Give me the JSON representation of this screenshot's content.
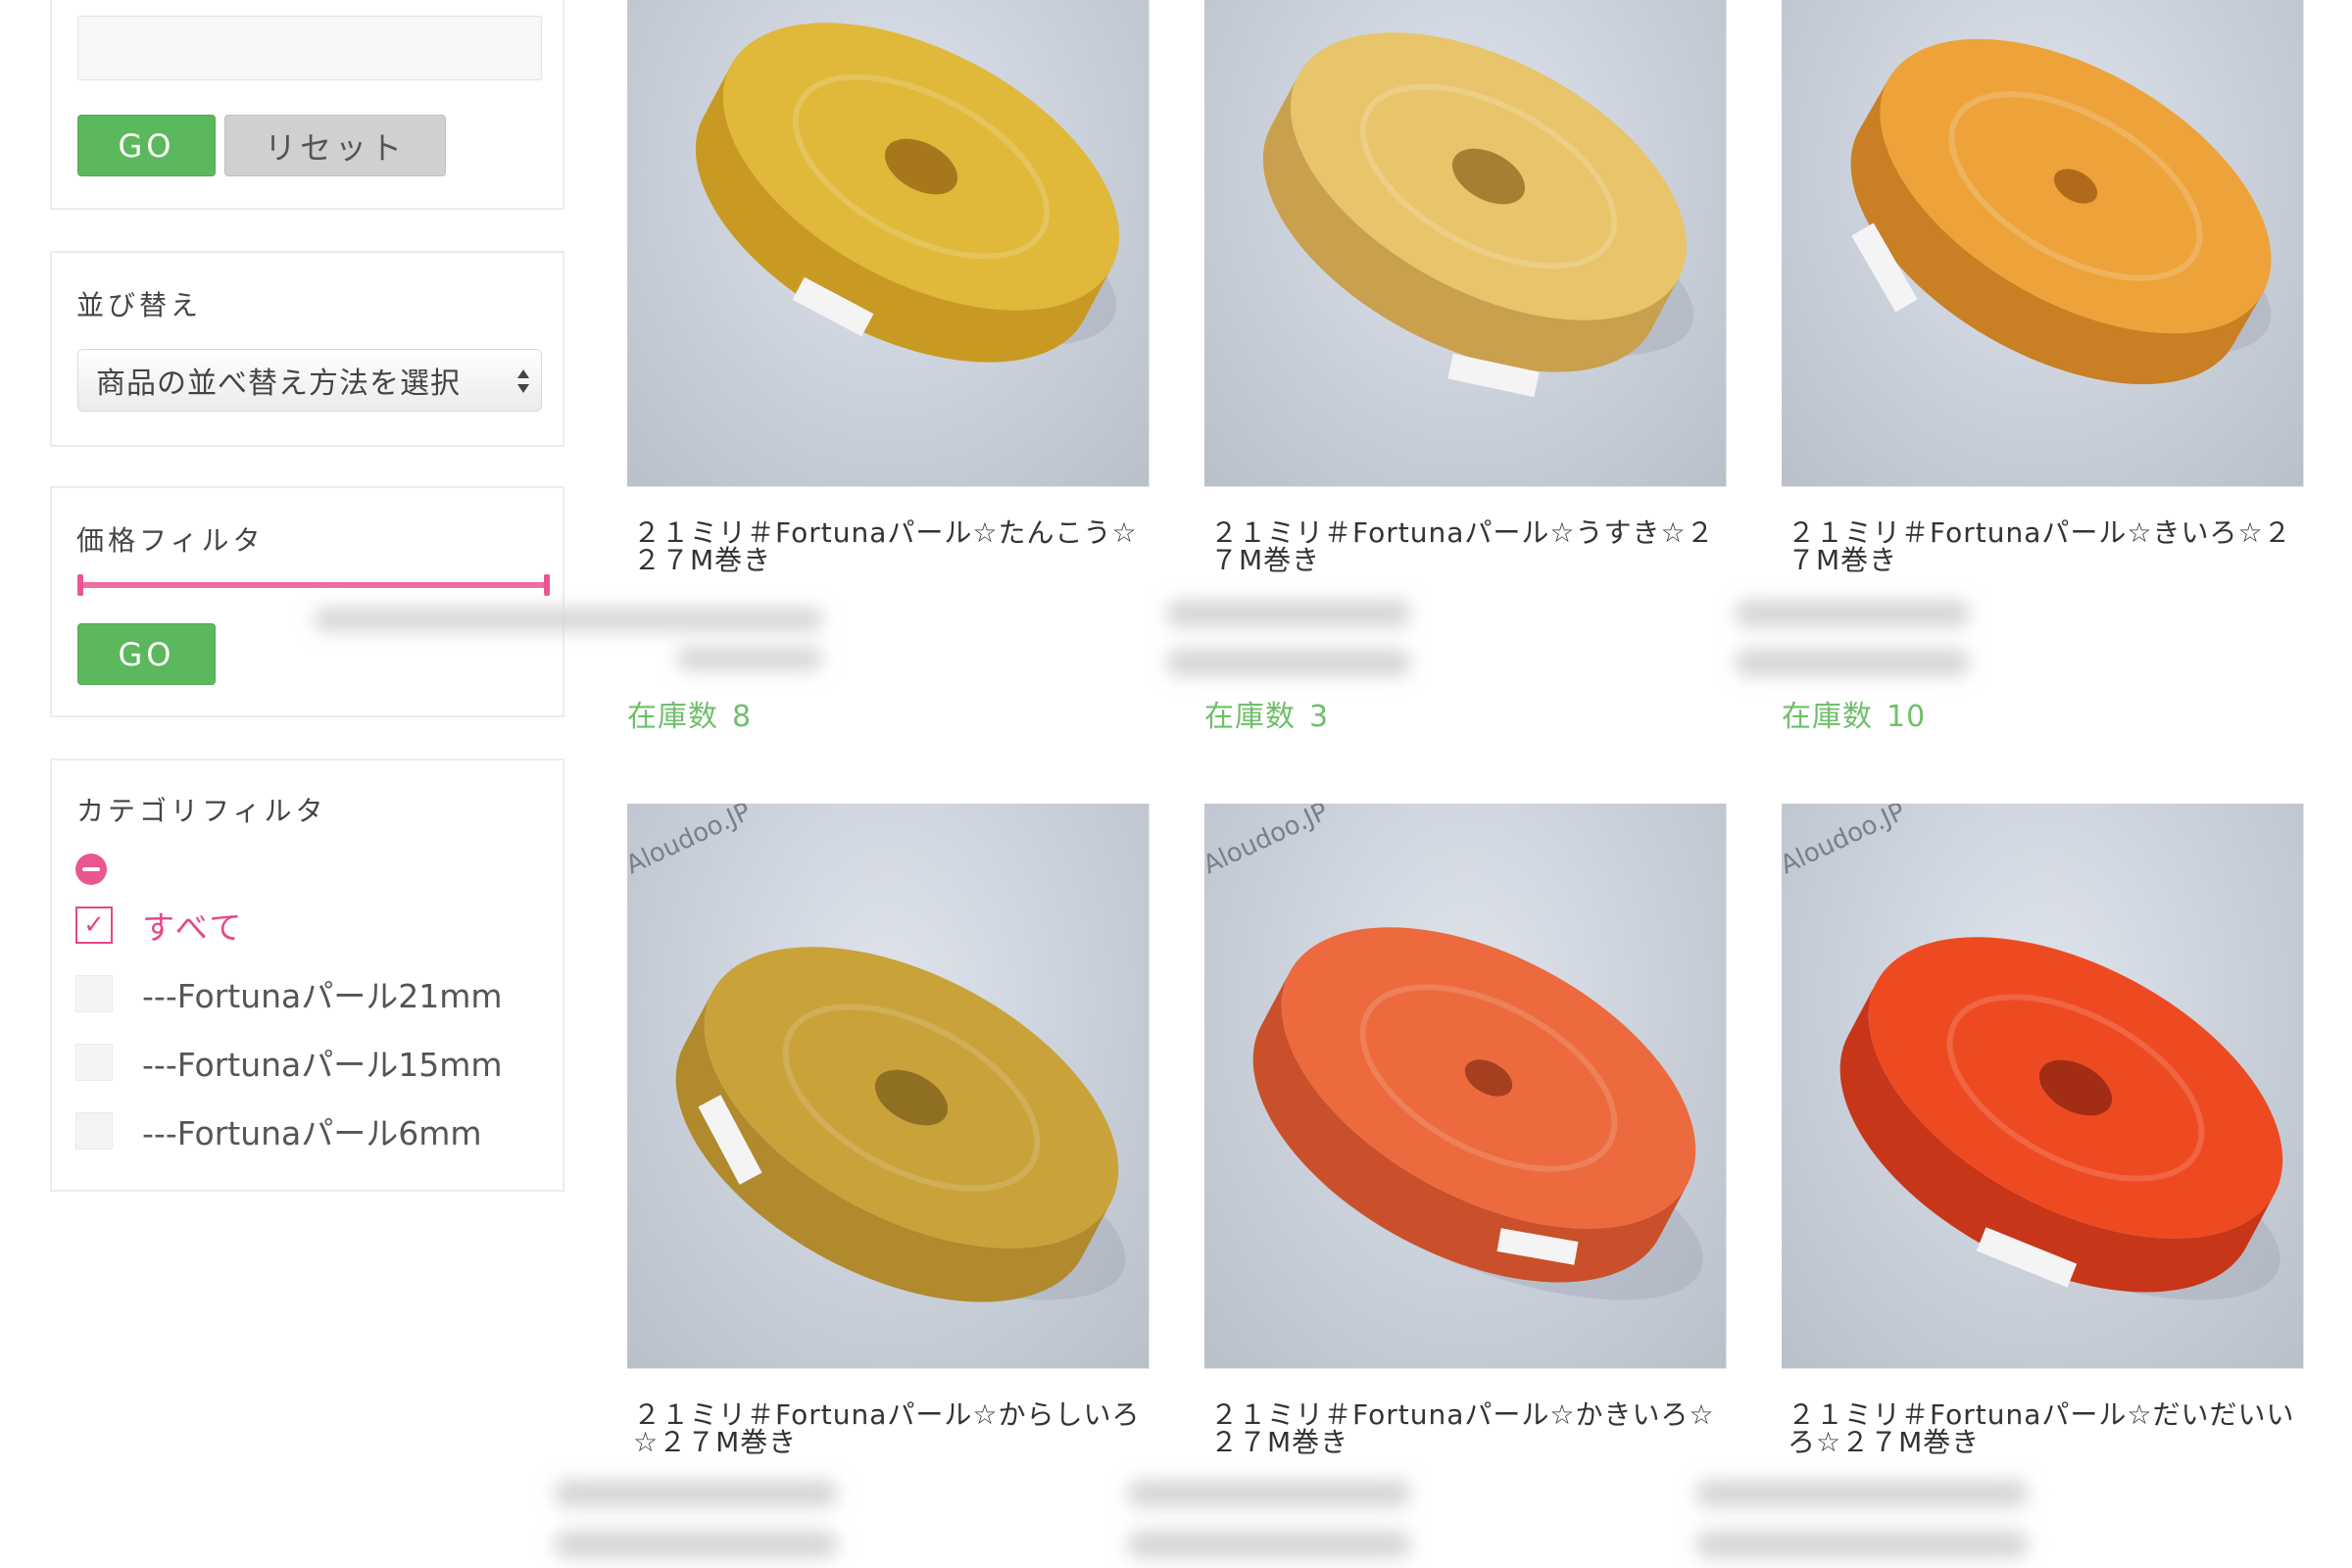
{
  "sidebar": {
    "search": {
      "go_label": "GO",
      "reset_label": "リセット",
      "placeholder": ""
    },
    "sort": {
      "title": "並び替え",
      "select_value": "商品の並べ替え方法を選択"
    },
    "price_filter": {
      "title": "価格フィルタ",
      "go_label": "GO"
    },
    "category_filter": {
      "title": "カテゴリフィルタ",
      "items": [
        {
          "label": "すべて",
          "checked": true
        },
        {
          "label": "---Fortunaパール21mm",
          "checked": false
        },
        {
          "label": "---Fortunaパール15mm",
          "checked": false
        },
        {
          "label": "---Fortunaパール6mm",
          "checked": false
        }
      ]
    }
  },
  "products": [
    {
      "title": "２１ミリ＃Fortunaパール☆たんこう☆２７M巻き",
      "stock_label": "在庫数",
      "stock": "8",
      "color": "#e0b83a",
      "code": "001F-21001"
    },
    {
      "title": "２１ミリ＃Fortunaパール☆うすき☆２７M巻き",
      "stock_label": "在庫数",
      "stock": "3",
      "color": "#e8c46a",
      "code": "001F-21002"
    },
    {
      "title": "２１ミリ＃Fortunaパール☆きいろ☆２７M巻き",
      "stock_label": "在庫数",
      "stock": "10",
      "color": "#eda33a",
      "code": "001F-21003"
    },
    {
      "title": "２１ミリ＃Fortunaパール☆からしいろ☆２７M巻き",
      "stock_label": "",
      "stock": "",
      "color": "#c9a23a",
      "code": "001F-21004"
    },
    {
      "title": "２１ミリ＃Fortunaパール☆かきいろ☆２７M巻き",
      "stock_label": "",
      "stock": "",
      "color": "#ec6a3e",
      "code": "001F-21005"
    },
    {
      "title": "２１ミリ＃Fortunaパール☆だいだいいろ☆２７M巻き",
      "stock_label": "",
      "stock": "",
      "color": "#ee4a22",
      "code": "001F-21006"
    }
  ],
  "watermark": "Aloudoo.JP"
}
